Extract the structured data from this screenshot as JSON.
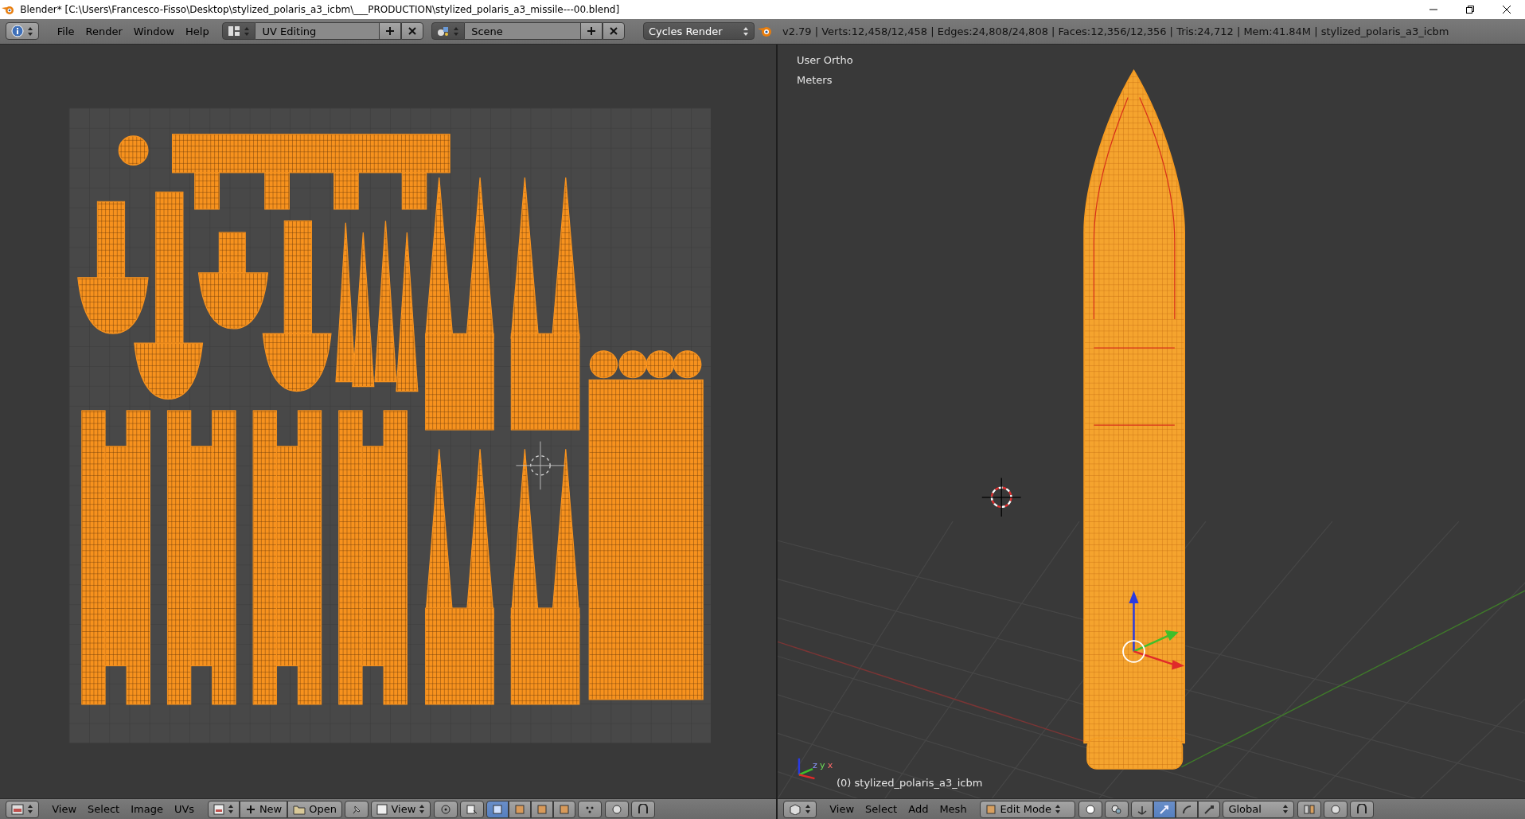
{
  "window": {
    "title": "Blender* [C:\\Users\\Francesco-Fisso\\Desktop\\stylized_polaris_a3_icbm\\___PRODUCTION\\stylized_polaris_a3_missile---00.blend]"
  },
  "top_header": {
    "menus": [
      "File",
      "Render",
      "Window",
      "Help"
    ],
    "screen_layout": "UV Editing",
    "scene": "Scene",
    "render_engine": "Cycles Render",
    "stats": "v2.79 | Verts:12,458/12,458 | Edges:24,808/24,808 | Faces:12,356/12,356 | Tris:24,712 | Mem:41.84M | stylized_polaris_a3_icbm"
  },
  "uv_editor": {
    "header": {
      "menus": [
        "View",
        "Select",
        "Image",
        "UVs"
      ],
      "new_button": "New",
      "open_button": "Open",
      "view_mode": "View",
      "selection_modes": [
        {
          "selected": true
        },
        {
          "selected": false
        },
        {
          "selected": false
        },
        {
          "selected": false
        }
      ]
    }
  },
  "viewport": {
    "view_name": "User Ortho",
    "units": "Meters",
    "object_label": "(0) stylized_polaris_a3_icbm",
    "axis_labels": [
      "z",
      "y",
      "x"
    ],
    "header": {
      "menus": [
        "View",
        "Select",
        "Add",
        "Mesh"
      ],
      "mode": "Edit Mode",
      "orientation": "Global",
      "transform_tools": [
        {
          "kind": "translate",
          "selected": true
        },
        {
          "kind": "rotate",
          "selected": false
        },
        {
          "kind": "scale",
          "selected": false
        }
      ]
    }
  }
}
